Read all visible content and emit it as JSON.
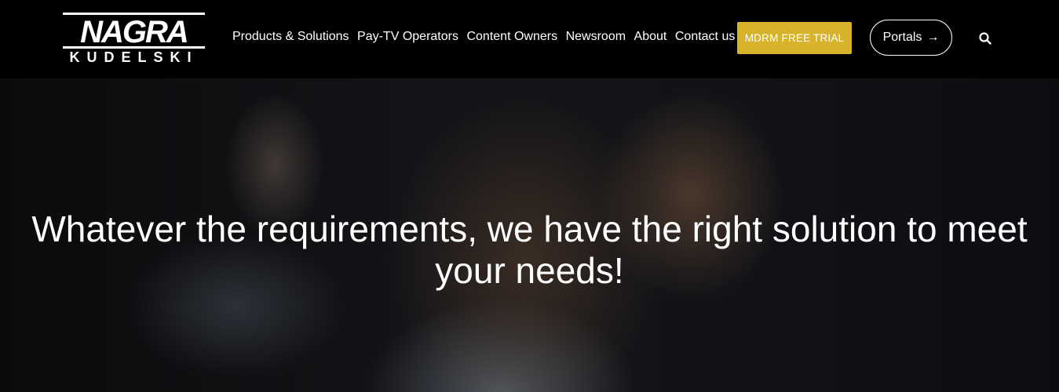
{
  "logo": {
    "top_text": "NAGRA",
    "bottom_text": "KUDELSKI"
  },
  "nav": {
    "items": [
      {
        "label": "Products & Solutions"
      },
      {
        "label": "Pay-TV Operators"
      },
      {
        "label": "Content Owners"
      },
      {
        "label": "Newsroom"
      },
      {
        "label": "About"
      },
      {
        "label": "Contact us"
      }
    ],
    "cta_label": "MDRM FREE TRIAL",
    "portals_label": "Portals",
    "portals_arrow": "→",
    "search_icon": "search-icon"
  },
  "hero": {
    "headline": "Whatever the requirements, we have the right solution to meet your needs!"
  },
  "colors": {
    "header_bg": "#000000",
    "cta_bg": "#d6b32a",
    "text": "#ffffff"
  }
}
